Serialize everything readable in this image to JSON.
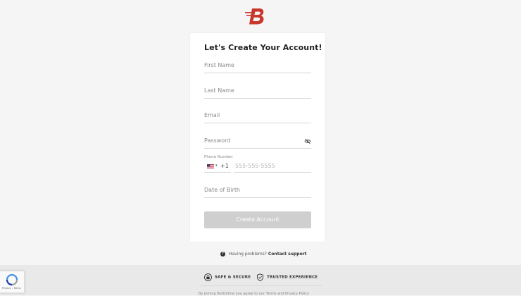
{
  "brand": {
    "logo_letter": "B",
    "accent_color": "#c8362c"
  },
  "form": {
    "title": "Let's Create Your Account!",
    "first_name_placeholder": "First Name",
    "last_name_placeholder": "Last Name",
    "email_placeholder": "Email",
    "password_placeholder": "Password",
    "password_toggle_icon": "eye-slash-icon",
    "phone_label": "Phone Number",
    "country_flag_icon": "us-flag-icon",
    "country_caret": "▾",
    "dial_code": "+1",
    "phone_placeholder": "555-555-5555",
    "dob_placeholder": "Date of Birth",
    "submit_label": "Create Account",
    "submit_color": "#cfcfcf"
  },
  "help": {
    "icon": "question-circle-icon",
    "text": "Having problems?",
    "link": "Contact support"
  },
  "footer": {
    "safe_label": "SAFE & SECURE",
    "safe_icon": "lock-icon",
    "trusted_label": "TRUSTED EXPERIENCE",
    "trusted_icon": "shield-check-icon",
    "legal_text": "By joining BetOnline you agree to our Terms and Privacy Policy"
  },
  "recaptcha": {
    "text": "Privacy - Terms",
    "icon": "recaptcha-icon"
  }
}
